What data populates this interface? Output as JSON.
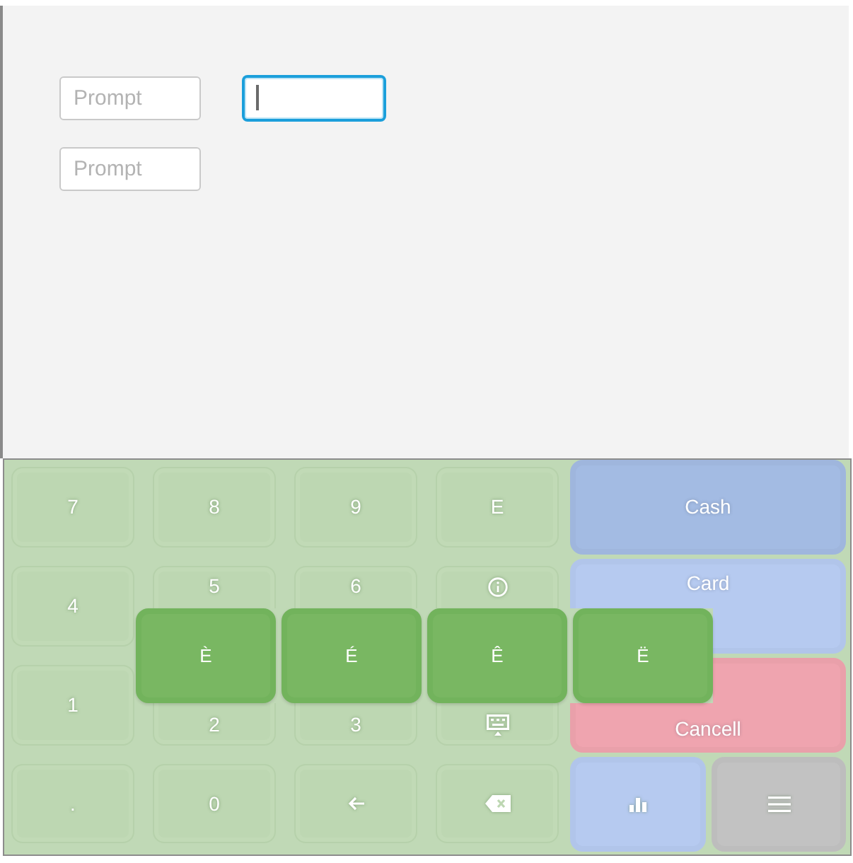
{
  "form": {
    "rows": [
      {
        "fields": [
          {
            "placeholder": "Prompt",
            "focused": false
          },
          {
            "focused": true
          }
        ]
      },
      {
        "fields": [
          {
            "placeholder": "Prompt",
            "focused": false
          }
        ]
      }
    ]
  },
  "keyboard": {
    "rows": [
      {
        "keys": [
          {
            "kind": "char",
            "label": "7"
          },
          {
            "kind": "char",
            "label": "8"
          },
          {
            "kind": "char",
            "label": "9"
          },
          {
            "kind": "char",
            "label": "E"
          },
          {
            "kind": "action",
            "label": "Cash",
            "color": "#a3bbe3"
          }
        ]
      },
      {
        "keys": [
          {
            "kind": "char",
            "label": "4"
          },
          {
            "kind": "char",
            "label": "5"
          },
          {
            "kind": "char",
            "label": "6"
          },
          {
            "kind": "info"
          },
          {
            "kind": "action",
            "label": "Card",
            "color": "#b6caf0"
          }
        ]
      },
      {
        "keys": [
          {
            "kind": "char",
            "label": "1"
          },
          {
            "kind": "char",
            "label": "2"
          },
          {
            "kind": "char",
            "label": "3"
          },
          {
            "kind": "hide"
          },
          {
            "kind": "action",
            "label": "Cancell",
            "color": "#efa4af"
          }
        ]
      },
      {
        "keys": [
          {
            "kind": "char",
            "label": "."
          },
          {
            "kind": "char",
            "label": "0"
          },
          {
            "kind": "left"
          },
          {
            "kind": "backspace"
          },
          {
            "kind": "stats",
            "color": "#b6caf0"
          },
          {
            "kind": "menu",
            "color": "#c2c2c2"
          }
        ]
      }
    ]
  },
  "accent_popup": {
    "keys": [
      {
        "label": "È"
      },
      {
        "label": "É"
      },
      {
        "label": "Ê"
      },
      {
        "label": "Ë"
      }
    ]
  }
}
